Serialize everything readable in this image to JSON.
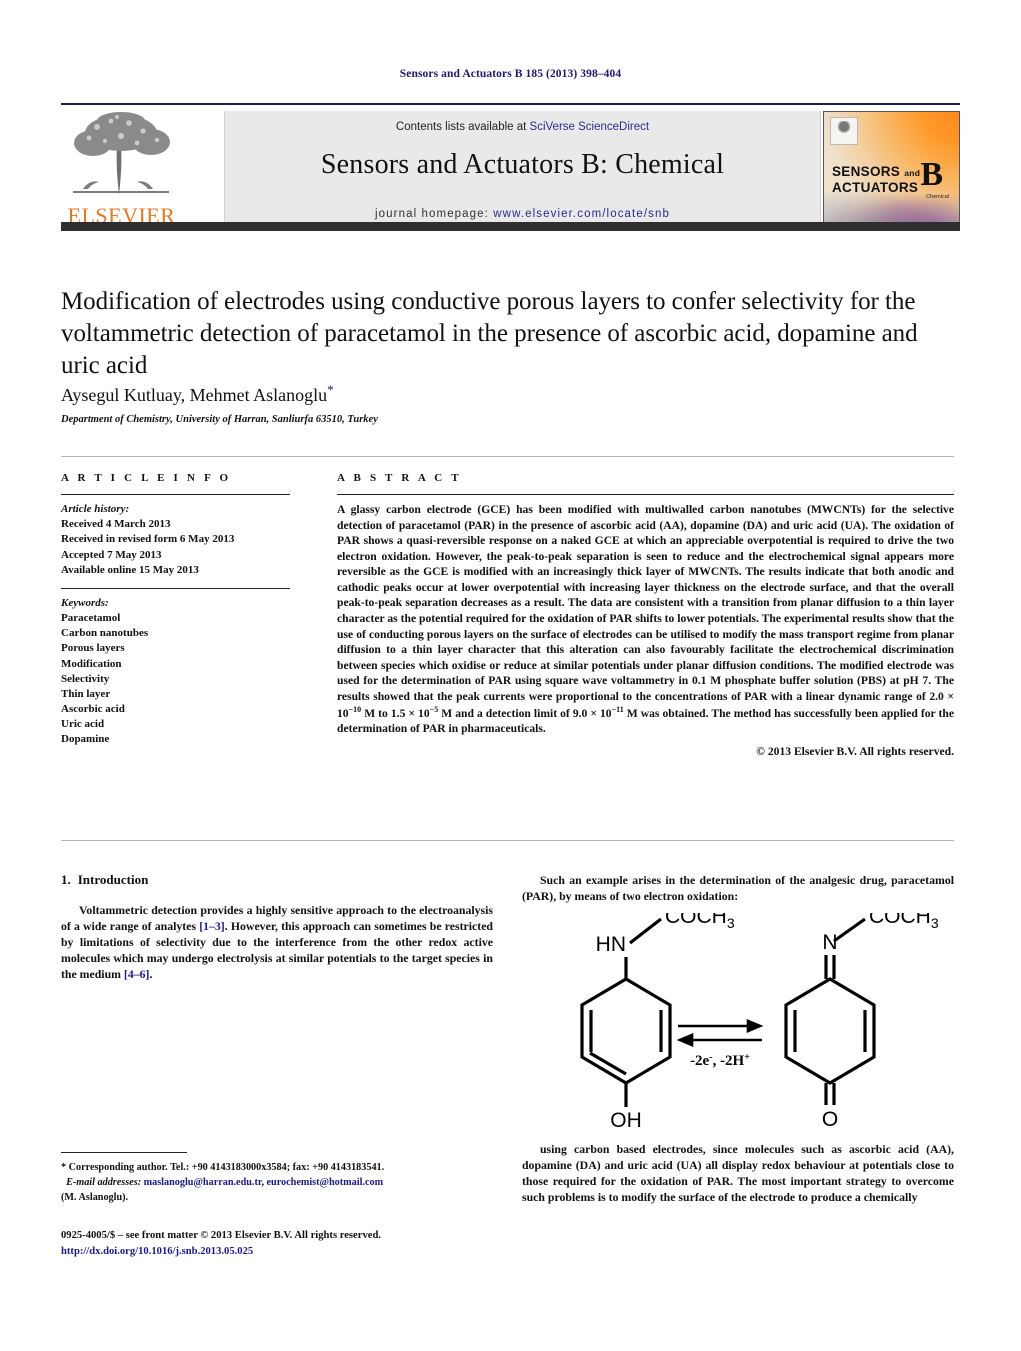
{
  "running_head": "Sensors and Actuators B 185 (2013) 398–404",
  "masthead": {
    "contents_prefix": "Contents lists available at ",
    "contents_link": "SciVerse ScienceDirect",
    "journal_title": "Sensors and Actuators B: Chemical",
    "homepage_prefix": "journal homepage: ",
    "homepage_url": "www.elsevier.com/locate/snb",
    "publisher_wordmark": "ELSEVIER",
    "cover": {
      "line1": "SENSORS",
      "line1_small": "and",
      "line2": "ACTUATORS",
      "series": "B",
      "series_sub": "Chemical"
    }
  },
  "article": {
    "title": "Modification of electrodes using conductive porous layers to confer selectivity for the voltammetric detection of paracetamol in the presence of ascorbic acid, dopamine and uric acid",
    "authors": "Aysegul Kutluay, Mehmet Aslanoglu",
    "author_marker": "*",
    "affiliation": "Department of Chemistry, University of Harran, Sanliurfa 63510, Turkey"
  },
  "article_info": {
    "heading": "A R T I C L E   I N F O",
    "history_label": "Article history:",
    "history": [
      "Received 4 March 2013",
      "Received in revised form 6 May 2013",
      "Accepted 7 May 2013",
      "Available online 15 May 2013"
    ],
    "keywords_label": "Keywords:",
    "keywords": [
      "Paracetamol",
      "Carbon nanotubes",
      "Porous layers",
      "Modification",
      "Selectivity",
      "Thin layer",
      "Ascorbic acid",
      "Uric acid",
      "Dopamine"
    ]
  },
  "abstract": {
    "heading": "A B S T R A C T",
    "part1": "A glassy carbon electrode (GCE) has been modified with multiwalled carbon nanotubes (MWCNTs) for the selective detection of paracetamol (PAR) in the presence of ascorbic acid (AA), dopamine (DA) and uric acid (UA). The oxidation of PAR shows a quasi-reversible response on a naked GCE at which an appreciable overpotential is required to drive the two electron oxidation. However, the peak-to-peak separation is seen to reduce and the electrochemical signal appears more reversible as the GCE is modified with an increasingly thick layer of MWCNTs. The results indicate that both anodic and cathodic peaks occur at lower overpotential with increasing layer thickness on the electrode surface, and that the overall peak-to-peak separation decreases as a result. The data are consistent with a transition from planar diffusion to a thin layer character as the potential required for the oxidation of PAR shifts to lower potentials. The experimental results show that the use of conducting porous layers on the surface of electrodes can be utilised to modify the mass transport regime from planar diffusion to a thin layer character that this alteration can also favourably facilitate the electrochemical discrimination between species which oxidise or reduce at similar potentials under planar diffusion conditions. The modified electrode was used for the determination of PAR using square wave voltammetry in 0.1 M phosphate buffer solution (PBS) at pH 7. The results showed that the peak currents were proportional to the concentrations of PAR with a linear dynamic range of 2.0 × 10",
    "exp1": "−10",
    "part2": " M to 1.5 × 10",
    "exp2": "−5",
    "part3": " M and a detection limit of 9.0 × 10",
    "exp3": "−11",
    "part4": " M was obtained. The method has successfully been applied for the determination of PAR in pharmaceuticals.",
    "copyright": "© 2013 Elsevier B.V. All rights reserved."
  },
  "introduction": {
    "number": "1.",
    "heading": "Introduction",
    "para1_a": "Voltammetric detection provides a highly sensitive approach to the electroanalysis of a wide range of analytes ",
    "para1_ref1": "[1–3]",
    "para1_b": ". However, this approach can sometimes be restricted by limitations of selectivity due to the interference from the other redox active molecules which may undergo electrolysis at similar potentials to the target species in the medium ",
    "para1_ref2": "[4–6]",
    "para1_c": "."
  },
  "right_column": {
    "para1": "Such an example arises in the determination of the analgesic drug, paracetamol (PAR), by means of two electron oxidation:",
    "para2": "using carbon based electrodes, since molecules such as ascorbic acid (AA), dopamine (DA) and uric acid (UA) all display redox behaviour at potentials close to those required for the oxidation of PAR. The most important strategy to overcome such problems is to modify the surface of the electrode to produce a chemically"
  },
  "scheme": {
    "left_top_label": "COCH",
    "left_top_sub": "3",
    "left_nh": "HN",
    "left_bottom": "OH",
    "right_top_label": "COCH",
    "right_top_sub": "3",
    "right_n": "N",
    "right_bottom": "O",
    "arrow_label_main": "-2e",
    "arrow_label_sup1": "-",
    "arrow_label_mid": ", -2H",
    "arrow_label_sup2": "+"
  },
  "footnote": {
    "marker": "*",
    "corresponding": " Corresponding author. Tel.: +90 4143183000x3584; fax: +90 4143183541.",
    "email_label": "E-mail addresses:",
    "email1": "maslanoglu@harran.edu.tr",
    "email_sep": ", ",
    "email2": "eurochemist@hotmail.com",
    "email_owner": "(M. Aslanoglu)."
  },
  "imprint": {
    "line1": "0925-4005/$ – see front matter © 2013 Elsevier B.V. All rights reserved.",
    "doi": "http://dx.doi.org/10.1016/j.snb.2013.05.025"
  }
}
